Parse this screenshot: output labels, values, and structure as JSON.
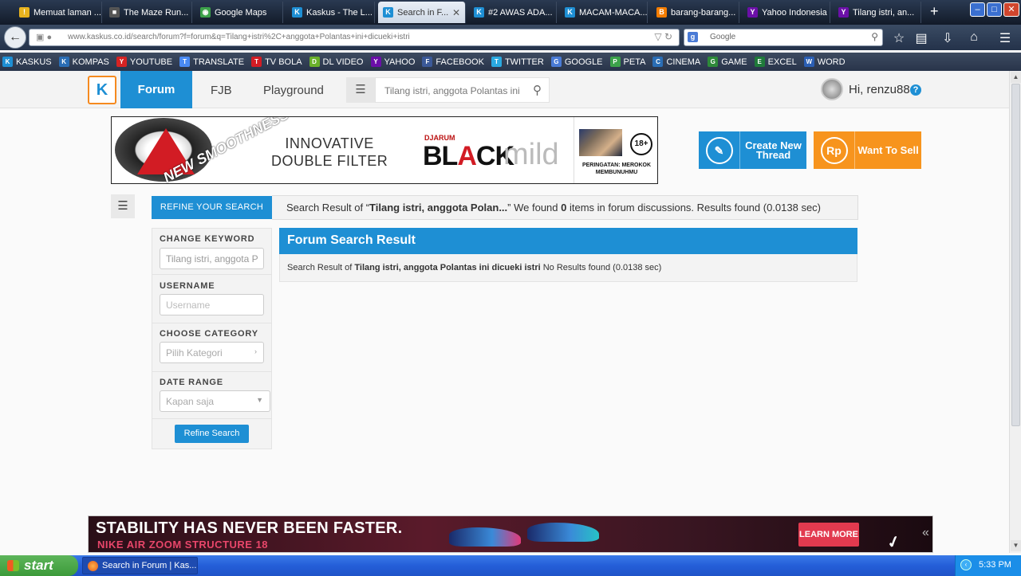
{
  "browser": {
    "tabs": [
      {
        "label": "Memuat laman ...",
        "icon": "warning-icon"
      },
      {
        "label": "The Maze Run...",
        "icon": "movie-icon"
      },
      {
        "label": "Google Maps",
        "icon": "maps-icon"
      },
      {
        "label": "Kaskus - The L...",
        "icon": "kaskus-icon"
      },
      {
        "label": "Search in F...",
        "icon": "kaskus-icon",
        "active": true
      },
      {
        "label": "#2 AWAS ADA...",
        "icon": "kaskus-icon"
      },
      {
        "label": "MACAM-MACA...",
        "icon": "kaskus-icon"
      },
      {
        "label": "barang-barang...",
        "icon": "blogger-icon"
      },
      {
        "label": "Yahoo Indonesia",
        "icon": "yahoo-icon"
      },
      {
        "label": "Tilang istri, an...",
        "icon": "yahoo-icon"
      }
    ],
    "url": "www.kaskus.co.id/search/forum?f=forum&q=Tilang+istri%2C+anggota+Polantas+ini+dicueki+istri",
    "search_engine": "Google",
    "bookmarks": [
      {
        "label": "KASKUS",
        "icon": "kaskus-icon",
        "color": "#1e8fd4"
      },
      {
        "label": "KOMPAS",
        "icon": "kompas-icon",
        "color": "#2a6db5"
      },
      {
        "label": "YOUTUBE",
        "icon": "youtube-icon",
        "color": "#d62323"
      },
      {
        "label": "TRANSLATE",
        "icon": "translate-icon",
        "color": "#4a8af4"
      },
      {
        "label": "TV BOLA",
        "icon": "tvbola-icon",
        "color": "#d21c24"
      },
      {
        "label": "DL VIDEO",
        "icon": "download-icon",
        "color": "#6ab02a"
      },
      {
        "label": "YAHOO",
        "icon": "yahoo-icon",
        "color": "#6b0fa8"
      },
      {
        "label": "FACEBOOK",
        "icon": "facebook-icon",
        "color": "#3b5998"
      },
      {
        "label": "TWITTER",
        "icon": "twitter-icon",
        "color": "#2aa9e0"
      },
      {
        "label": "GOOGLE",
        "icon": "google-icon",
        "color": "#4a7bd6"
      },
      {
        "label": "PETA",
        "icon": "maps-icon",
        "color": "#3ca24a"
      },
      {
        "label": "CINEMA",
        "icon": "cinema-icon",
        "color": "#2a6db5"
      },
      {
        "label": "GAME",
        "icon": "game-icon",
        "color": "#2e8a3a"
      },
      {
        "label": "EXCEL",
        "icon": "excel-icon",
        "color": "#1f7a3a"
      },
      {
        "label": "WORD",
        "icon": "word-icon",
        "color": "#2b5fb4"
      }
    ]
  },
  "site": {
    "nav": {
      "forum": "Forum",
      "fjb": "FJB",
      "playground": "Playground"
    },
    "search_value": "Tilang istri, anggota Polantas ini",
    "user": {
      "greeting": "Hi, renzu88",
      "help": "?"
    }
  },
  "ad_top": {
    "tagline": "NEW SMOOTHNESS",
    "line1": "INNOVATIVE",
    "line2": "DOUBLE FILTER",
    "brand_small": "DJARUM",
    "brand_black": "BLACK",
    "brand_mild": "mild",
    "age": "18+",
    "warning": "PERINGATAN: MEROKOK MEMBUNUHMU"
  },
  "cta": {
    "create_thread": "Create New Thread",
    "want_to_sell": "Want To Sell",
    "rp": "Rp",
    "create_color": "#1e8fd4",
    "sell_color": "#f7941d"
  },
  "refine": {
    "header": "REFINE YOUR SEARCH",
    "change_keyword_label": "CHANGE KEYWORD",
    "keyword_value": "Tilang istri, anggota P",
    "username_label": "USERNAME",
    "username_placeholder": "Username",
    "category_label": "CHOOSE CATEGORY",
    "category_value": "Pilih Kategori",
    "date_label": "DATE RANGE",
    "date_value": "Kapan saja",
    "button": "Refine Search"
  },
  "result_bar": {
    "prefix": "Search Result of “",
    "query": "Tilang istri, anggota Polan...",
    "mid": "” We found ",
    "count": "0",
    "suffix": " items in forum discussions. Results found (0.0138 sec)"
  },
  "forum_result": {
    "title": "Forum Search Result",
    "prefix": "Search Result of ",
    "query": "Tilang istri, anggota Polantas ini dicueki istri",
    "suffix": " No Results found (0.0138 sec)"
  },
  "ad_bottom": {
    "headline": "STABILITY HAS NEVER BEEN FASTER.",
    "sub": "NIKE AIR ZOOM STRUCTURE 18",
    "button": "LEARN MORE",
    "collapse": "«"
  },
  "taskbar": {
    "start": "start",
    "item": "Search in Forum | Kas...",
    "time": "5:33 PM"
  }
}
